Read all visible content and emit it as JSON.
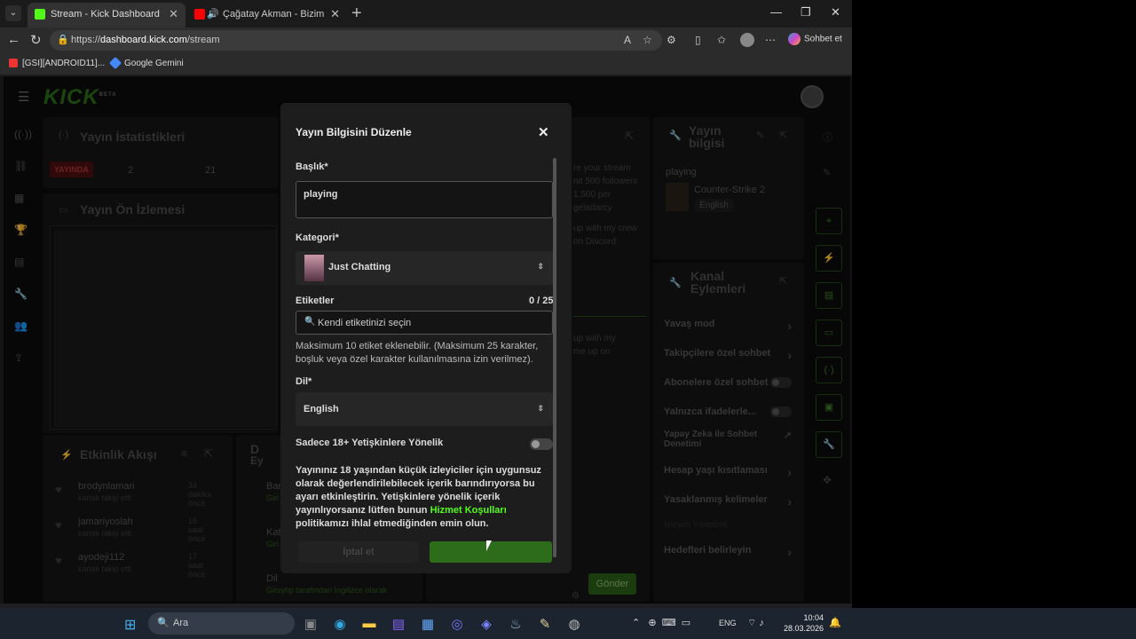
{
  "browser": {
    "tabs": [
      {
        "title": "Stream - Kick Dashboard",
        "favicon_color": "#53fc18"
      },
      {
        "title": "Çağatay Akman - Bizim Hikaye",
        "favicon_color": "#ff0000"
      }
    ],
    "url_prefix": "https://",
    "url_domain": "dashboard.kick.com",
    "url_path": "/stream",
    "copilot_label": "Sohbet et",
    "bookmarks": [
      {
        "label": "[GSI][ANDROID11]...",
        "color": "#e33"
      },
      {
        "label": "Google Gemini",
        "color": "#48f"
      }
    ]
  },
  "dashboard": {
    "logo": "KICK",
    "logo_beta": "BETA",
    "stats": {
      "title": "Yayın İstatistikleri",
      "live_badge": "YAYINDA",
      "value_a": "2",
      "value_b": "21"
    },
    "preview_title": "Yayın Ön İzlemesi",
    "partial_text": [
      "re your stream",
      "nit 500 followers",
      "1,500 per",
      "geladarcy",
      "up with my crew",
      "on Discord:",
      "up with my",
      "me up on"
    ],
    "activity": {
      "title": "Etkinlik Akışı",
      "items": [
        {
          "name": "brodynlamari",
          "sub": "kanalı takip etti",
          "when": "34 dakika önce"
        },
        {
          "name": "jamariyoslah",
          "sub": "kanalı takip etti",
          "when": "16 saat önce"
        },
        {
          "name": "ayodeji112",
          "sub": "kanalı takip etti",
          "when": "17 saat önce"
        }
      ]
    },
    "mid_panel": {
      "head": "D",
      "head2": "Ey",
      "rows": [
        {
          "t": "Bar",
          "s": "Giri"
        },
        {
          "t": "Kat",
          "s": "Giri"
        },
        {
          "t": "Dil",
          "s": "Girsyhp tarafından İngilizce olarak"
        }
      ]
    },
    "stream_info": {
      "title": "Yayın bilgisi",
      "stream_title": "playing",
      "category": "Counter-Strike 2",
      "language": "English"
    },
    "channel_actions": {
      "title": "Kanal Eylemleri",
      "items": [
        {
          "label": "Yavaş mod",
          "kind": "chevron"
        },
        {
          "label": "Takipçilere özel sohbet",
          "kind": "chevron"
        },
        {
          "label": "Abonelere özel sohbet",
          "kind": "switch"
        },
        {
          "label": "Yalnızca ifadelerle...",
          "kind": "switch"
        },
        {
          "label": "Yapay Zeka ile Sohbet Denetimi",
          "kind": "ext"
        },
        {
          "label": "Hesap yaşı kısıtlaması",
          "kind": "chevron"
        },
        {
          "label": "Yasaklanmış kelimeler",
          "kind": "chevron"
        },
        {
          "label": "İzleyici Yönetimi",
          "kind": "none"
        },
        {
          "label": "Hedefleri belirleyin",
          "kind": "chevron"
        }
      ]
    },
    "send_label": "Gönder"
  },
  "modal": {
    "title": "Yayın Bilgisini Düzenle",
    "title_label": "Başlık*",
    "title_value": "playing",
    "category_label": "Kategori*",
    "category_value": "Just Chatting",
    "tags_label": "Etiketler",
    "tags_count": "0 / 25",
    "tags_placeholder": "Kendi etiketinizi seçin",
    "tags_help": "Maksimum 10 etiket eklenebilir. (Maksimum 25 karakter, boşluk veya özel karakter kullanılmasına izin verilmez).",
    "language_label": "Dil*",
    "language_value": "English",
    "adult_label": "Sadece 18+ Yetişkinlere Yönelik",
    "adult_desc_1": "Yayınınız 18 yaşından küçük izleyiciler için uygunsuz olarak değerlendirilebilecek içerik barındırıyorsa bu ayarı etkinleştirin. Yetişkinlere yönelik içerik yayınlıyorsanız lütfen bunun ",
    "adult_link": "Hizmet Koşulları",
    "adult_desc_2": " politikamızı ihlal etmediğinden emin olun.",
    "cancel_label": "İptal et"
  },
  "taskbar": {
    "search_placeholder": "Ara",
    "lang": "ENG",
    "time": "10:04",
    "date": "28.03.2026"
  },
  "colors": {
    "accent": "#53fc18",
    "modal_bg": "#1d1d1d",
    "page_bg": "#0b0b0b"
  }
}
